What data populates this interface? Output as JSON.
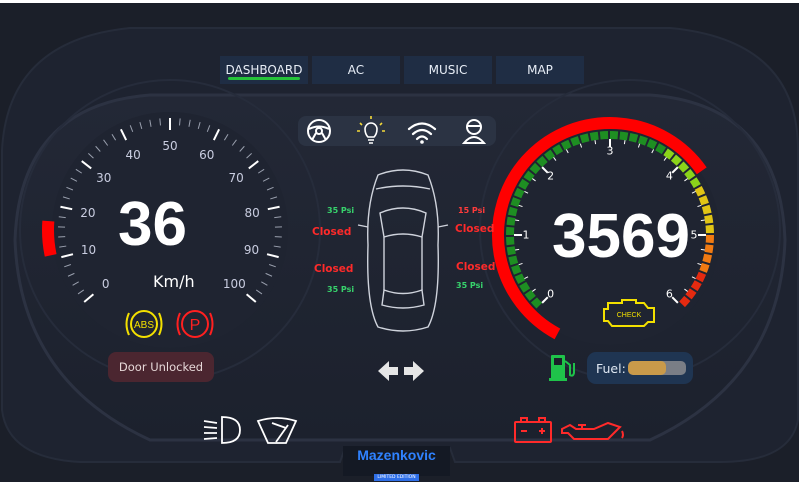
{
  "tabs": [
    {
      "label": "DASHBOARD",
      "active": true
    },
    {
      "label": "AC",
      "active": false
    },
    {
      "label": "MUSIC",
      "active": false
    },
    {
      "label": "MAP",
      "active": false
    }
  ],
  "top_icons": [
    "steering-wheel-icon",
    "light-bulb-icon",
    "wifi-icon",
    "driver-icon"
  ],
  "speedometer": {
    "value": "36",
    "unit": "Km/h",
    "max": 100,
    "ticks": [
      "0",
      "10",
      "20",
      "30",
      "40",
      "50",
      "60",
      "70",
      "80",
      "90",
      "100"
    ]
  },
  "tachometer": {
    "value": "3569",
    "ticks": [
      "0",
      "1",
      "2",
      "3",
      "4",
      "5",
      "6"
    ]
  },
  "warning_icons": {
    "abs": "ABS",
    "parking": "P",
    "check_engine": "CHECK"
  },
  "tires": {
    "front_left": {
      "pressure": "35 Psi",
      "door": "Closed"
    },
    "front_right": {
      "pressure": "15 Psi",
      "door": "Closed"
    },
    "rear_left": {
      "pressure": "35 Psi",
      "door": "Closed"
    },
    "rear_right": {
      "pressure": "35 Psi",
      "door": "Closed"
    }
  },
  "door_status": "Door Unlocked",
  "fuel": {
    "label": "Fuel:",
    "level": 0.65
  },
  "brand": {
    "name": "Mazenkovic",
    "edition": "LIMITED EDITION"
  },
  "bottom_icons": [
    "low-beam-icon",
    "wiper-icon",
    "battery-icon",
    "oil-can-icon"
  ],
  "colors": {
    "accent_red": "#ff0000",
    "tab_bg": "#1f2d44",
    "green": "#25c33a",
    "fuel_fill": "#c99a4a"
  }
}
